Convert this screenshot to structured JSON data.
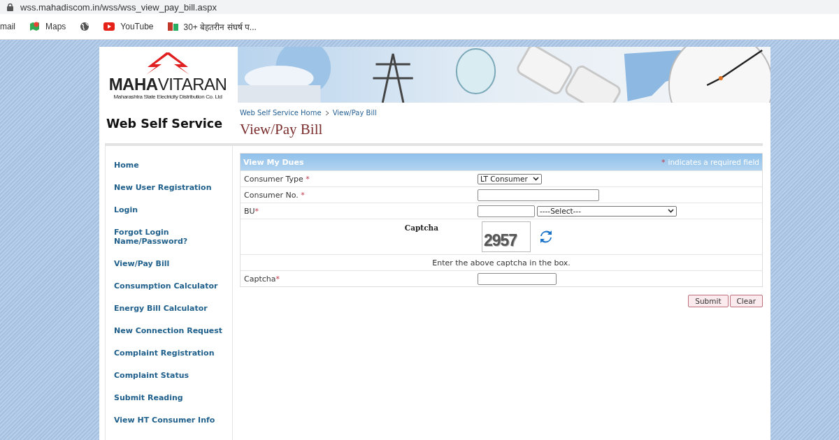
{
  "browser": {
    "url": "wss.mahadiscom.in/wss/wss_view_pay_bill.aspx",
    "bookmarks": [
      {
        "kind": "mail",
        "label": "mail"
      },
      {
        "kind": "maps",
        "label": "Maps"
      },
      {
        "kind": "globe"
      },
      {
        "kind": "youtube",
        "label": "YouTube"
      },
      {
        "kind": "site",
        "label": "30+ बेहतरीन संघर्ष प..."
      }
    ]
  },
  "header": {
    "logo": {
      "name": "**MAHA**VITARAN",
      "subtitle": "Maharashtra State Electricity Distribution Co. Ltd"
    }
  },
  "site_title": "Web Self Service",
  "breadcrumb": [
    "Web Self Service Home",
    "View/Pay Bill"
  ],
  "page_title": "View/Pay Bill",
  "sidebar": {
    "items": [
      {
        "label": "Home"
      },
      {
        "label": "New User Registration"
      },
      {
        "label": "Login"
      },
      {
        "label": "Forgot Login Name/Password?"
      },
      {
        "label": "View/Pay Bill"
      },
      {
        "label": "Consumption Calculator"
      },
      {
        "label": "Energy Bill Calculator"
      },
      {
        "label": "New Connection Request"
      },
      {
        "label": "Complaint Registration"
      },
      {
        "label": "Complaint Status"
      },
      {
        "label": "Submit Reading"
      },
      {
        "label": "View HT Consumer Info"
      }
    ]
  },
  "form": {
    "title": "View My Dues",
    "required_note": {
      "mark": "*",
      "text": "indicates a required field"
    },
    "rows": [
      {
        "kind": "select",
        "label": "Consumer Type",
        "mark": " *",
        "value": "LT Consumer"
      },
      {
        "kind": "input",
        "label": "Consumer No.",
        "mark": " *"
      },
      {
        "kind": "bu",
        "label": "BU",
        "mark": "*",
        "select_value": "----Select---"
      },
      {
        "kind": "captcha",
        "label": "Captcha",
        "code": "2957"
      },
      {
        "kind": "note",
        "text": "Enter the above captcha in the box."
      },
      {
        "kind": "input_short",
        "label": "Captcha",
        "mark": "*"
      }
    ],
    "buttons": [
      "Submit",
      "Clear"
    ]
  }
}
